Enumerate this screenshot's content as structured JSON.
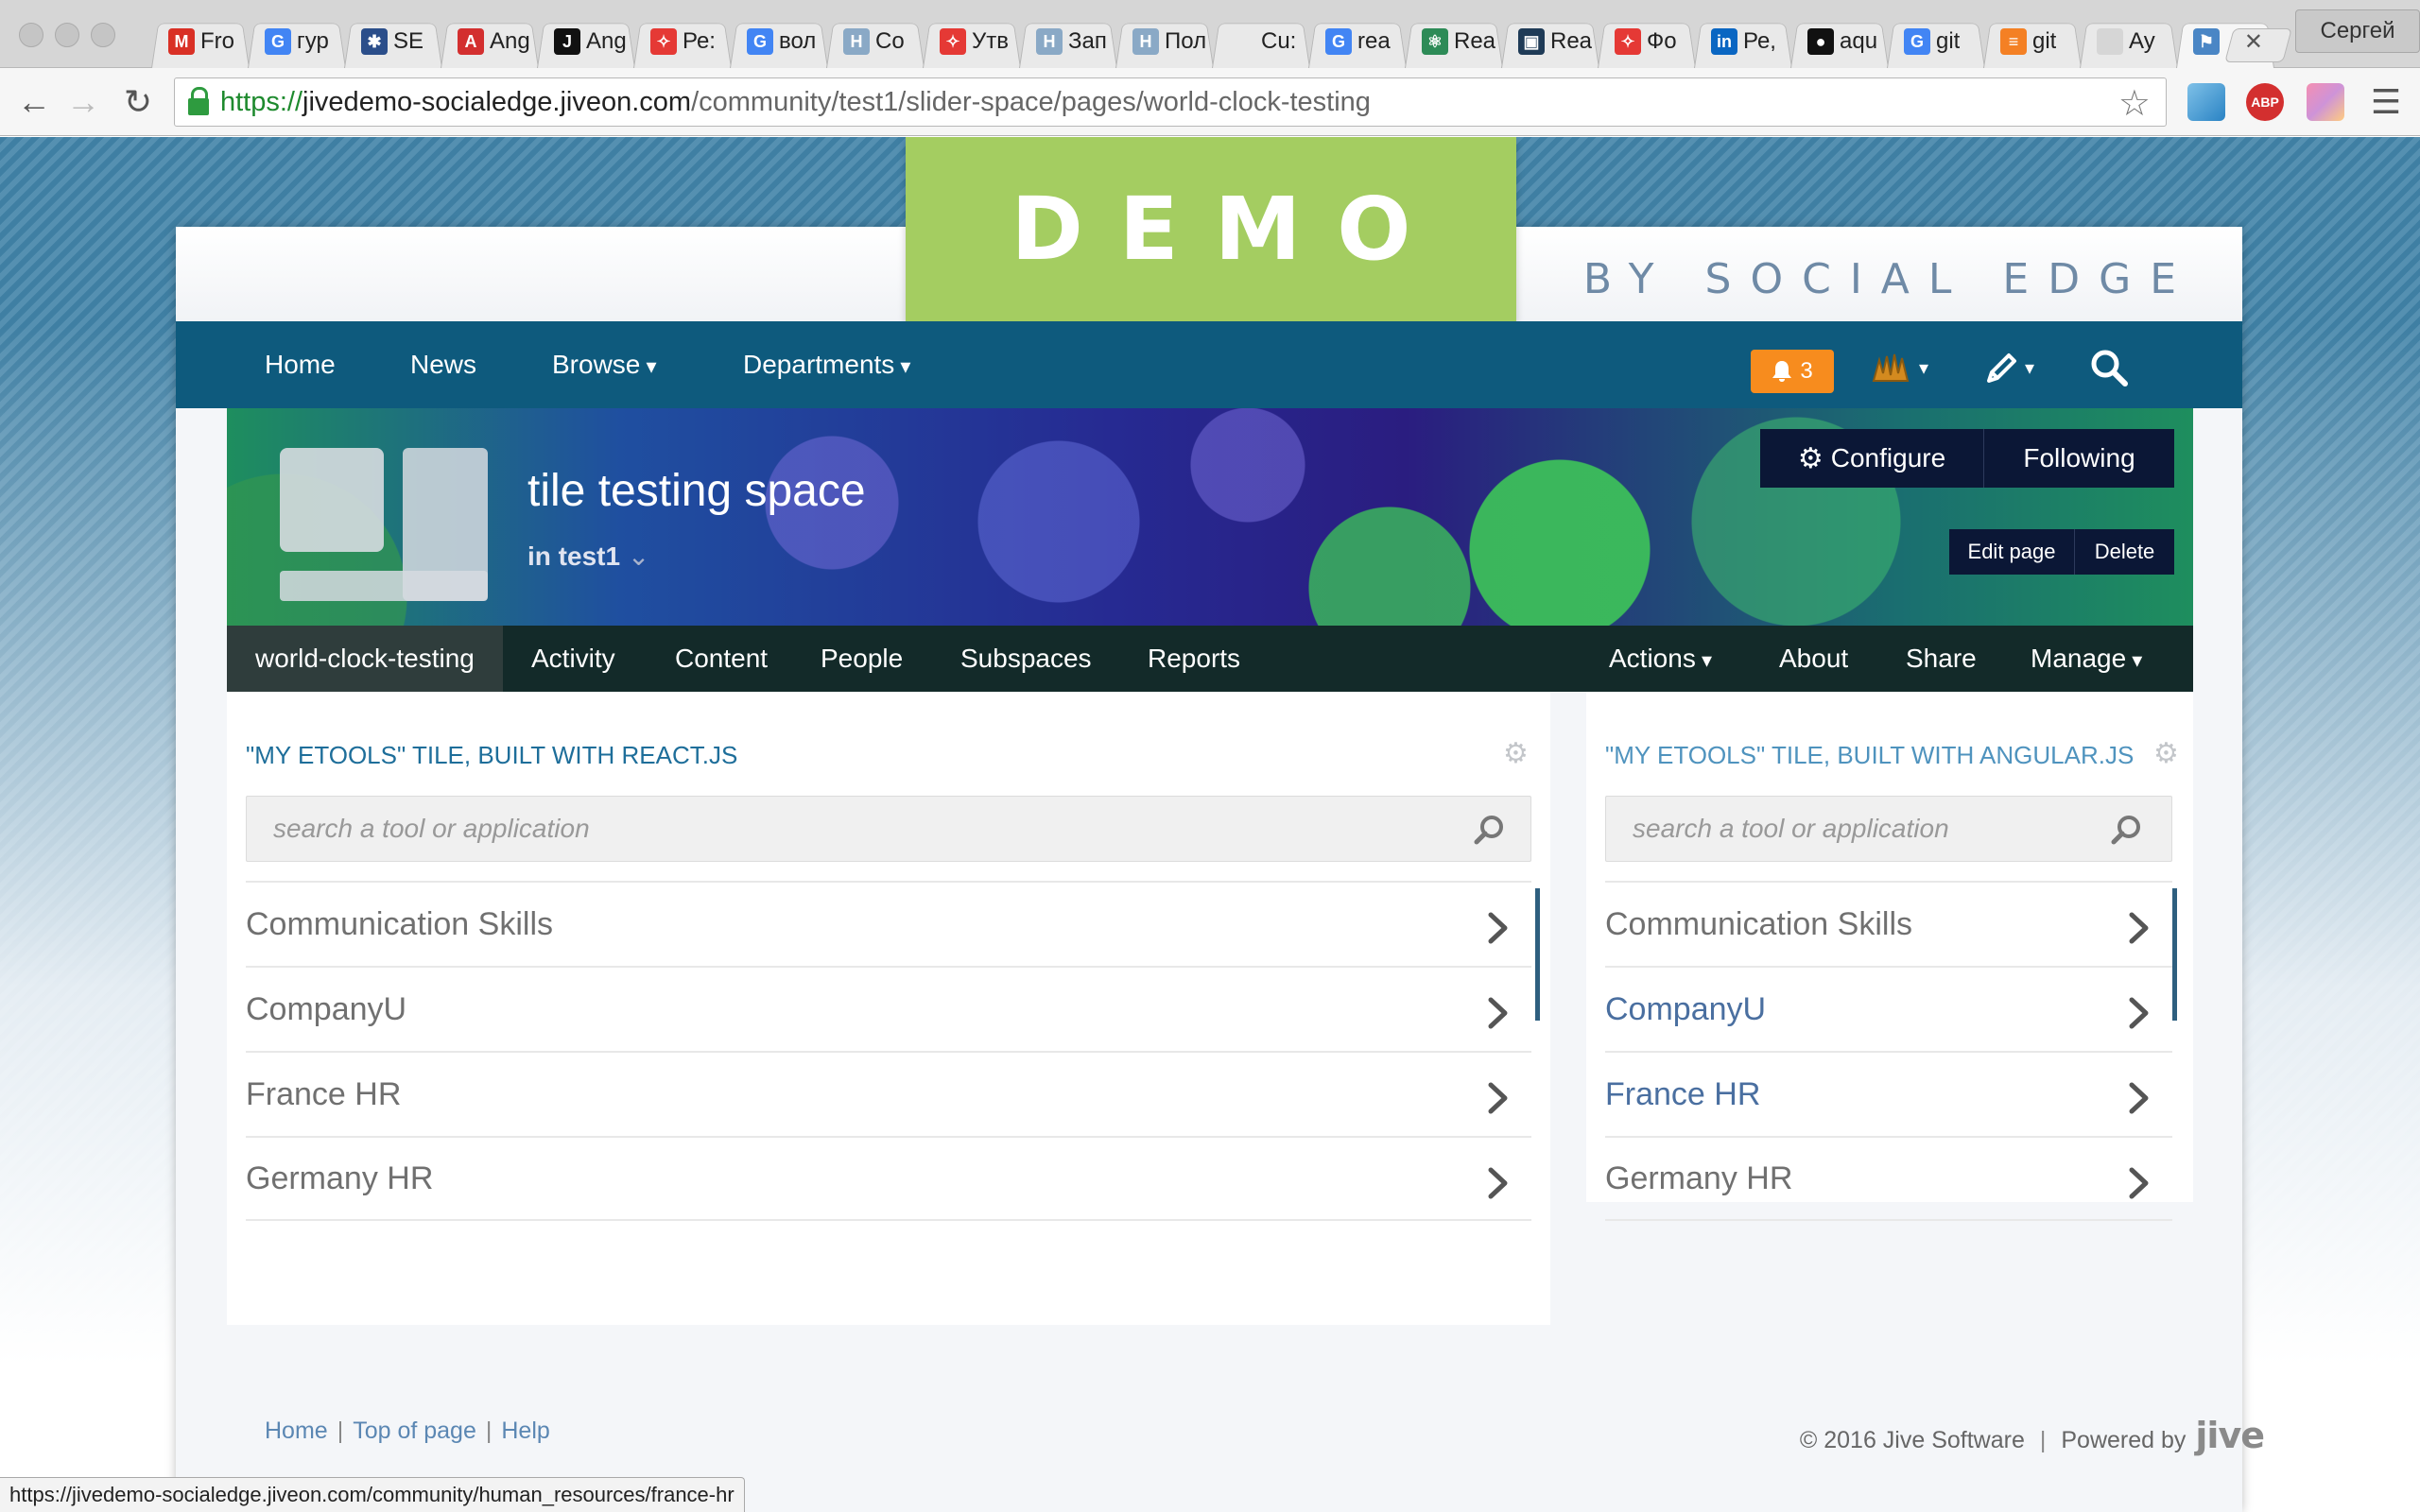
{
  "browser": {
    "tabs": [
      {
        "title": "Fro",
        "favicon": "gmail-icon",
        "color": "#d93025",
        "glyph": "M"
      },
      {
        "title": "гур",
        "favicon": "google-icon",
        "color": "#4285f4",
        "glyph": "G"
      },
      {
        "title": "SE",
        "favicon": "se-icon",
        "color": "#2b4e8a",
        "glyph": "✱"
      },
      {
        "title": "Ang",
        "favicon": "angular-icon",
        "color": "#d32f2f",
        "glyph": "A"
      },
      {
        "title": "Ang",
        "favicon": "j-icon",
        "color": "#111111",
        "glyph": "J"
      },
      {
        "title": "Ре:",
        "favicon": "jive-red-icon",
        "color": "#e53935",
        "glyph": "✧"
      },
      {
        "title": "вол",
        "favicon": "google-icon",
        "color": "#4285f4",
        "glyph": "G"
      },
      {
        "title": "Co",
        "favicon": "h-icon",
        "color": "#8aa9c6",
        "glyph": "H"
      },
      {
        "title": "Утв",
        "favicon": "jive-red-icon",
        "color": "#e53935",
        "glyph": "✧"
      },
      {
        "title": "Зап",
        "favicon": "h-icon",
        "color": "#8aa9c6",
        "glyph": "H"
      },
      {
        "title": "Пол",
        "favicon": "h-icon",
        "color": "#8aa9c6",
        "glyph": "H"
      },
      {
        "title": "Cu:",
        "favicon": "blank-icon",
        "color": "#e9e9e9",
        "glyph": ""
      },
      {
        "title": "rea",
        "favicon": "google-icon",
        "color": "#4285f4",
        "glyph": "G"
      },
      {
        "title": "Rea",
        "favicon": "react-icon",
        "color": "#2d8b57",
        "glyph": "⚛"
      },
      {
        "title": "Rea",
        "favicon": "monitor-icon",
        "color": "#1f3b57",
        "glyph": "▣"
      },
      {
        "title": "Фо",
        "favicon": "jive-red-icon",
        "color": "#e53935",
        "glyph": "✧"
      },
      {
        "title": "Ре,",
        "favicon": "linkedin-icon",
        "color": "#0a66c2",
        "glyph": "in"
      },
      {
        "title": "aqu",
        "favicon": "github-icon",
        "color": "#111111",
        "glyph": "●"
      },
      {
        "title": "git",
        "favicon": "google-icon",
        "color": "#4285f4",
        "glyph": "G"
      },
      {
        "title": "git",
        "favicon": "stackoverflow-icon",
        "color": "#f48024",
        "glyph": "≡"
      },
      {
        "title": "Ау",
        "favicon": "audio-icon",
        "color": "#d6d6d6",
        "glyph": ""
      },
      {
        "title": "",
        "favicon": "flag-icon",
        "color": "#4a86c5",
        "glyph": "⚑",
        "active": true
      }
    ],
    "profile_name": "Сергей",
    "url": {
      "scheme": "https://",
      "host": "jivedemo-socialedge.jiveon.com",
      "path": "/community/test1/slider-space/pages/world-clock-testing"
    },
    "status_url": "https://jivedemo-socialedge.jiveon.com/community/human_resources/france-hr",
    "ext_abp": "ABP"
  },
  "brand": {
    "demo": "DEMO",
    "tagline": "BY SOCIAL EDGE",
    "accent_green": "#a4cd61",
    "nav_blue": "#0e5a7d",
    "badge_orange": "#f78c1e"
  },
  "nav": {
    "home": "Home",
    "news": "News",
    "browse": "Browse",
    "departments": "Departments",
    "notifications": "3"
  },
  "space": {
    "title": "tile testing space",
    "parent_prefix": "in",
    "parent": "test1",
    "configure": "Configure",
    "following": "Following",
    "edit_page": "Edit page",
    "delete": "Delete"
  },
  "subnav": {
    "active": "world-clock-testing",
    "activity": "Activity",
    "content": "Content",
    "people": "People",
    "subspaces": "Subspaces",
    "reports": "Reports",
    "actions": "Actions",
    "about": "About",
    "share": "Share",
    "manage": "Manage"
  },
  "tiles": {
    "react": {
      "title": "\"MY ETOOLS\" TILE, BUILT WITH REACT.JS",
      "placeholder": "search a tool or application",
      "items": [
        "Communication Skills",
        "CompanyU",
        "France HR",
        "Germany HR"
      ]
    },
    "angular": {
      "title": "\"MY ETOOLS\" TILE, BUILT WITH ANGULAR.JS",
      "placeholder": "search a tool or application",
      "items": [
        "Communication Skills",
        "CompanyU",
        "France HR",
        "Germany HR"
      ]
    }
  },
  "footer": {
    "home": "Home",
    "top": "Top of page",
    "help": "Help",
    "copyright": "© 2016 Jive Software",
    "powered": "Powered by",
    "jive": "jive"
  }
}
